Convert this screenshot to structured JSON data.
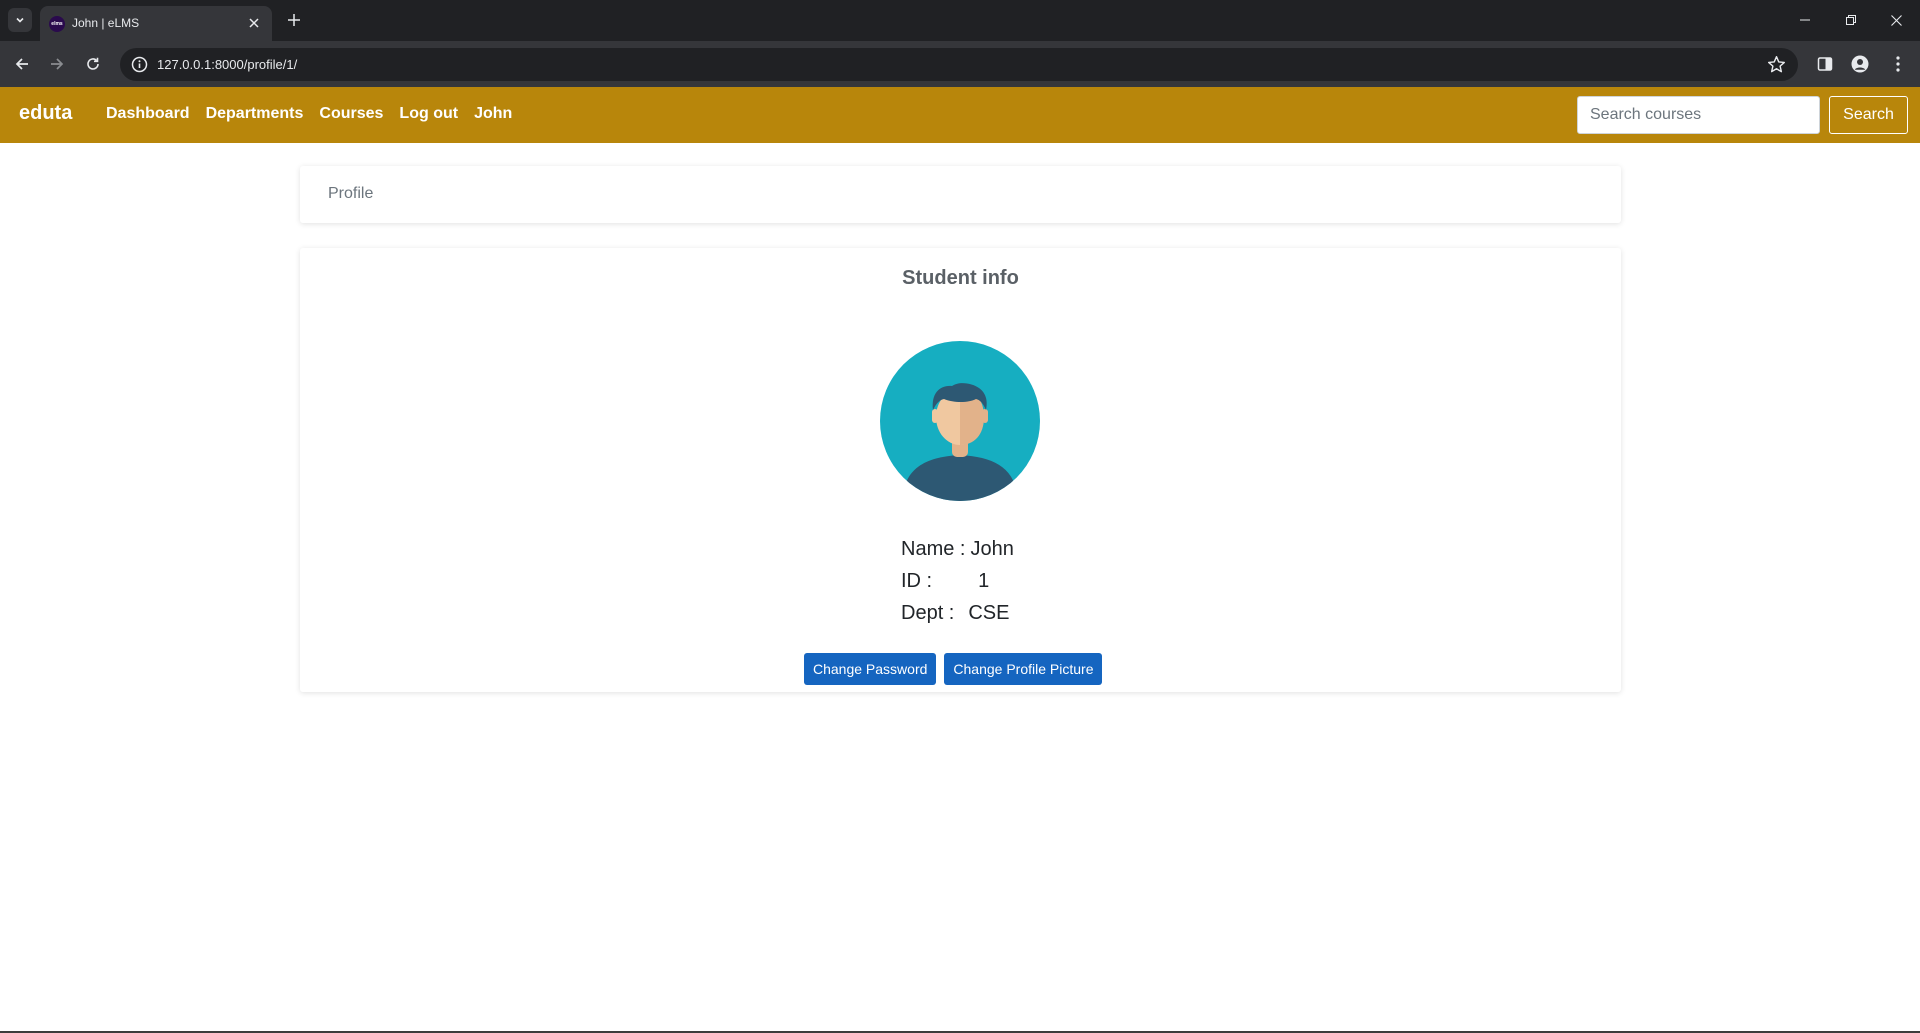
{
  "browser": {
    "tab_title": "John | eLMS",
    "favicon_text": "elms",
    "url": "127.0.0.1:8000/profile/1/"
  },
  "navbar": {
    "brand": "eduta",
    "links": [
      "Dashboard",
      "Departments",
      "Courses",
      "Log out",
      "John"
    ],
    "search_placeholder": "Search courses",
    "search_button": "Search",
    "color": "#b8860b"
  },
  "breadcrumb": {
    "current": "Profile"
  },
  "student_info": {
    "title": "Student info",
    "name_label": "Name :",
    "name": "John",
    "id_label": "ID :",
    "id": "1",
    "dept_label": "Dept :",
    "dept": "CSE",
    "avatar_icon": "user-avatar-icon"
  },
  "actions": {
    "change_password": "Change Password",
    "change_picture": "Change Profile Picture",
    "button_color": "#1565c0"
  }
}
